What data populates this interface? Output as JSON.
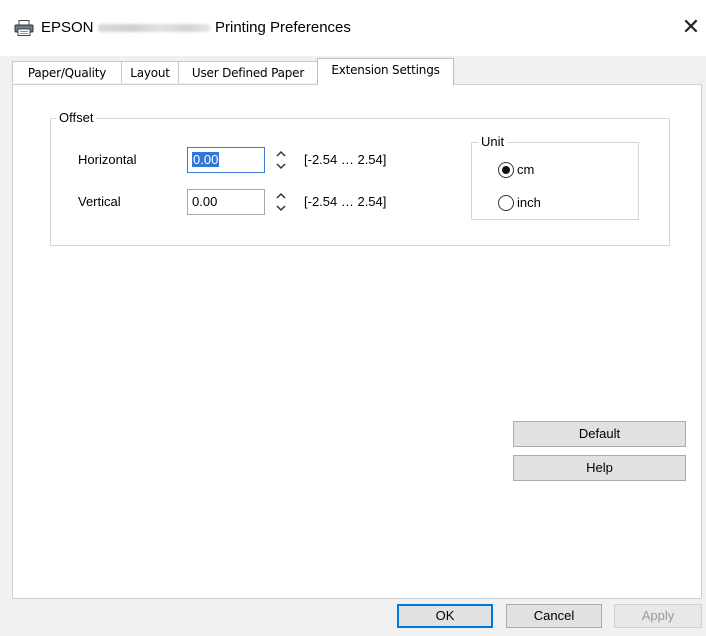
{
  "titlebar": {
    "brand": "EPSON",
    "title": "Printing Preferences",
    "close_glyph": "✕",
    "icon": "printer-icon"
  },
  "tabs": [
    {
      "label": "Paper/Quality",
      "active": false
    },
    {
      "label": "Layout",
      "active": false
    },
    {
      "label": "User Defined Paper",
      "active": false
    },
    {
      "label": "Extension Settings",
      "active": true
    }
  ],
  "offset": {
    "group_label": "Offset",
    "horizontal": {
      "label": "Horizontal",
      "value": "0.00",
      "range": "[-2.54 … 2.54]"
    },
    "vertical": {
      "label": "Vertical",
      "value": "0.00",
      "range": "[-2.54 … 2.54]"
    }
  },
  "unit": {
    "group_label": "Unit",
    "options": [
      {
        "label": "cm",
        "checked": true
      },
      {
        "label": "inch",
        "checked": false
      }
    ]
  },
  "buttons": {
    "default": "Default",
    "help": "Help",
    "ok": "OK",
    "cancel": "Cancel",
    "apply": "Apply"
  },
  "colors": {
    "focus": "#3377dd",
    "primary_border": "#0078d7"
  }
}
